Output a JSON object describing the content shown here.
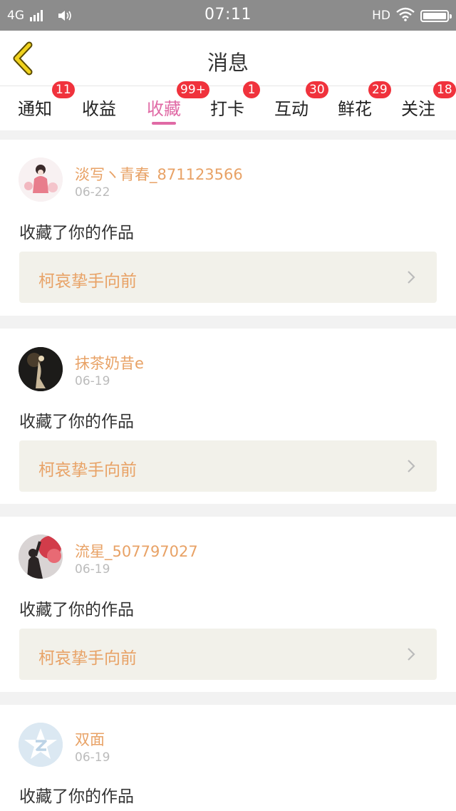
{
  "status_bar": {
    "network": "4G",
    "time": "07:11",
    "hd": "HD"
  },
  "header": {
    "title": "消息"
  },
  "tabs": [
    {
      "label": "通知",
      "badge": "11"
    },
    {
      "label": "收益",
      "badge": ""
    },
    {
      "label": "收藏",
      "badge": "99+",
      "active": true
    },
    {
      "label": "打卡",
      "badge": "1"
    },
    {
      "label": "互动",
      "badge": "30"
    },
    {
      "label": "鲜花",
      "badge": "29"
    },
    {
      "label": "关注",
      "badge": "18"
    }
  ],
  "messages": [
    {
      "user": "淡写ヽ青春_871123566",
      "date": "06-22",
      "text": "收藏了你的作品",
      "work": "柯哀挚手向前"
    },
    {
      "user": "抹茶奶昔e",
      "date": "06-19",
      "text": "收藏了你的作品",
      "work": "柯哀挚手向前"
    },
    {
      "user": "流星_507797027",
      "date": "06-19",
      "text": "收藏了你的作品",
      "work": "柯哀挚手向前"
    },
    {
      "user": "双面",
      "date": "06-19",
      "text": "收藏了你的作品",
      "work": ""
    }
  ],
  "colors": {
    "accent": "#e06aa5",
    "username": "#e8a266",
    "badge": "#f0323c",
    "status_bar": "#8c8c8c"
  }
}
